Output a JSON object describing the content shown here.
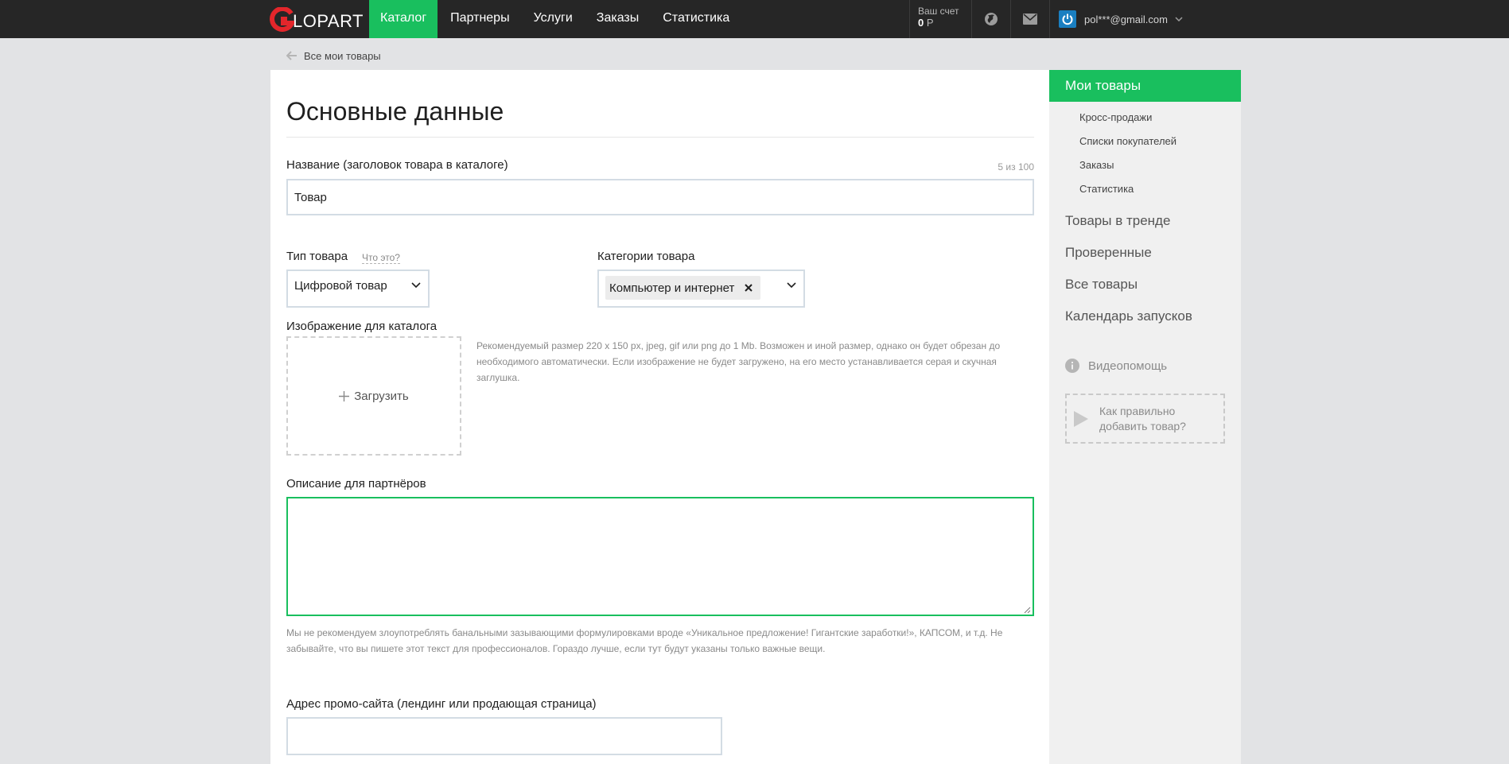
{
  "app": {
    "logo_text": "LOPART",
    "logo_letter": "G"
  },
  "nav": {
    "items": [
      {
        "label": "Каталог",
        "active": true
      },
      {
        "label": "Партнеры",
        "active": false
      },
      {
        "label": "Услуги",
        "active": false
      },
      {
        "label": "Заказы",
        "active": false
      },
      {
        "label": "Статистика",
        "active": false
      }
    ]
  },
  "account": {
    "balance_label": "Ваш счет",
    "balance_value": "0",
    "currency": "Р",
    "email": "pol***@gmail.com"
  },
  "breadcrumb": {
    "back_label": "Все мои товары"
  },
  "form": {
    "title": "Основные данные",
    "name": {
      "label": "Название (заголовок товара в каталоге)",
      "counter": "5 из 100",
      "value": "Товар"
    },
    "type": {
      "label": "Тип товара",
      "hint_link": "Что это?",
      "value": "Цифровой товар"
    },
    "categories": {
      "label": "Категории товара",
      "selected": "Компьютер и интернет"
    },
    "image": {
      "label": "Изображение для каталога",
      "upload_label": "Загрузить",
      "hint": "Рекомендуемый размер 220 x 150 px, jpeg, gif или png до 1 Mb. Возможен и иной размер, однако он будет обрезан до необходимого автоматически. Если изображение не будет загружено, на его место устанавливается серая и скучная заглушка."
    },
    "description": {
      "label": "Описание для партнёров",
      "value": "",
      "hint": "Мы не рекомендуем злоупотреблять банальными зазывающими формулировками вроде «Уникальное предложение! Гигантские заработки!», КАПСОМ, и т.д. Не забывайте, что вы пишете этот текст для профессионалов. Гораздо лучше, если тут будут указаны только важные вещи."
    },
    "promo_site": {
      "label": "Адрес промо-сайта (лендинг или продающая страница)",
      "value": ""
    }
  },
  "sidebar": {
    "active_label": "Мои товары",
    "sub_items": [
      "Кросс-продажи",
      "Списки покупателей",
      "Заказы",
      "Статистика"
    ],
    "main_items": [
      "Товары в тренде",
      "Проверенные",
      "Все товары",
      "Календарь запусков"
    ],
    "video_help_label": "Видеопомощь",
    "video_card_text": "Как правильно добавить товар?"
  },
  "colors": {
    "accent": "#19bf5e",
    "topbar": "#262626",
    "brand_red": "#e3262b",
    "avatar_blue": "#1a7fc1"
  },
  "icons": {
    "globe": "globe-icon",
    "mail": "mail-icon",
    "power": "power-icon",
    "back": "arrow-left-icon",
    "plus": "plus-icon",
    "info": "info-icon",
    "play": "play-icon",
    "close": "close-icon",
    "chevron": "chevron-down-icon"
  }
}
